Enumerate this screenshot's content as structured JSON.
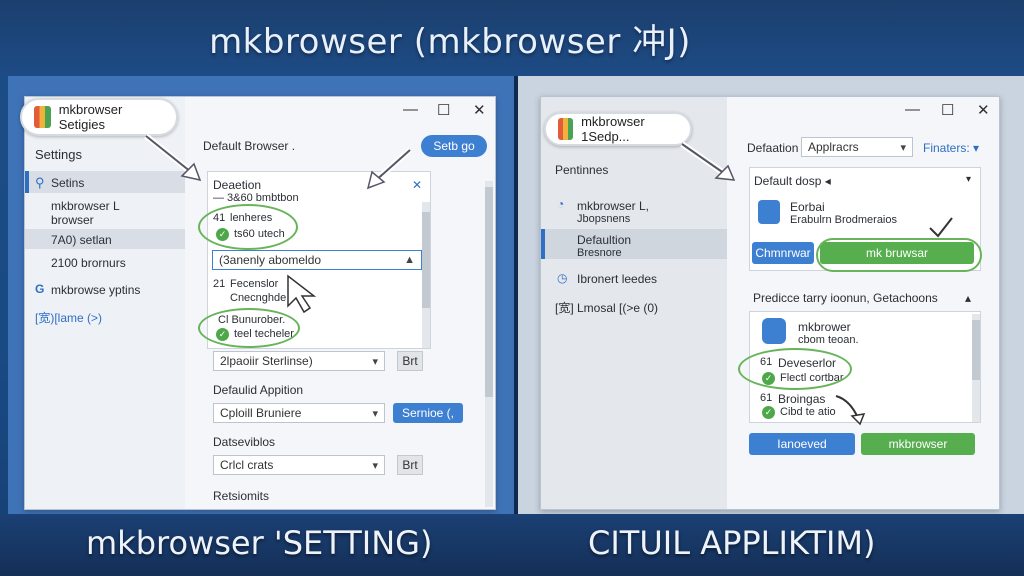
{
  "banner": {
    "title": "mkbrowser (mkbrowser 冲J)",
    "caption_left": "mkbrowser 'SETTING)",
    "caption_right": "CITUIL APPLIKTIM)"
  },
  "window_controls": {
    "minimize": "—",
    "maximize": "☐",
    "close": "✕"
  },
  "left": {
    "app_pill": "mkbrowser Setigies",
    "sidebar_title": "Settings",
    "sidebar_items": [
      {
        "label": "Setins"
      },
      {
        "label": "mkbrowser L"
      },
      {
        "label": "browser"
      },
      {
        "label": "7A0) setlan"
      },
      {
        "label": "2100 brornurs"
      },
      {
        "label": "mkbrowse yptins"
      },
      {
        "label": "[宽)[lame (>)"
      }
    ],
    "header_label": "Default Browser .",
    "setup_button": "Setb go",
    "card": {
      "title": "Deaetion",
      "subtitle": "— 3&60 bmbtbon",
      "close": "✕",
      "item1_num": "41",
      "item1_name": "lenheres",
      "item1_sub": "ts60 utech",
      "search_value": "(3anenly abomeldo",
      "item2_num": "21",
      "item2_name": "Fecenslor",
      "item2_sub": "Cnecnghde",
      "item3_name": "Cl Bunurober.",
      "item3_sub": "teel techeler"
    },
    "row1": {
      "select": "2lpaoiir Sterlinse)",
      "button": "Brt"
    },
    "section_default_app": "Defaulid Appition",
    "row2": {
      "select": "Cploill Bruniere",
      "button": "Sernioe (,"
    },
    "section_detes": "Datseviblos",
    "row3": {
      "select": "Crlcl crats",
      "button": "Brt"
    },
    "section_last": "Retsiomits"
  },
  "right": {
    "app_pill": "mkbrowser 1Sedp...",
    "sidebar_title": "Pentinnes",
    "sidebar_items": [
      {
        "label": "mkbrowser L,",
        "sub": "Jbopsnens"
      },
      {
        "label": "Defaultion",
        "sub": "Bresnore"
      },
      {
        "label": "Ibronert leedes"
      },
      {
        "label": "[宽] Lmosal [(>e (0)"
      }
    ],
    "header_label": "Defaation",
    "header_select": "Applracrs",
    "filters": "Finaters: ▾",
    "default_dosp": "Default dosp ◂",
    "app_card": {
      "title": "Eorbai",
      "sub": "Erabulrn Brodmeraios"
    },
    "btn_blue1": "Chmnrwar",
    "btn_green1": "mk bruwsar",
    "section_title": "Predicce tarry ioonun, Getachoons",
    "list": [
      {
        "name": "mkbrower",
        "sub": "cbom teoan."
      },
      {
        "num": "61",
        "name": "Deveserlor",
        "sub": "Flectl cortbar"
      },
      {
        "num": "61",
        "name": "Broingas",
        "sub": "Cibd te atio"
      }
    ],
    "btn_blue2": "Ianoeved",
    "btn_green2": "mkbrowser"
  },
  "colors": {
    "accent_blue": "#3d7fd1",
    "accent_green": "#56ae4e",
    "banner_bg": "#1d4b85"
  }
}
